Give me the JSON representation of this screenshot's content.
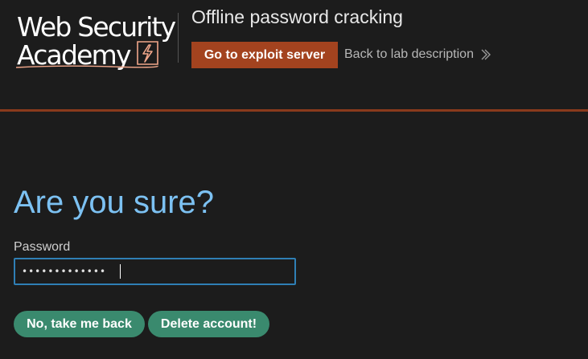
{
  "header": {
    "logo": {
      "line1": "Web Security",
      "line2": "Academy"
    },
    "lab_title": "Offline password cracking",
    "exploit_button_label": "Go to exploit server",
    "back_link_label": "Back to lab description",
    "accent_color": "#a3431f"
  },
  "main": {
    "heading": "Are you sure?",
    "password_label": "Password",
    "password_value": "•••••••••••••",
    "buttons": {
      "back_label": "No, take me back",
      "delete_label": "Delete account!"
    },
    "button_color": "#3a8a6e",
    "heading_color": "#7cc1f2"
  },
  "icons": {
    "logo_bolt": "lightning-bolt-icon",
    "back_chevron": "double-chevron-right-icon"
  }
}
